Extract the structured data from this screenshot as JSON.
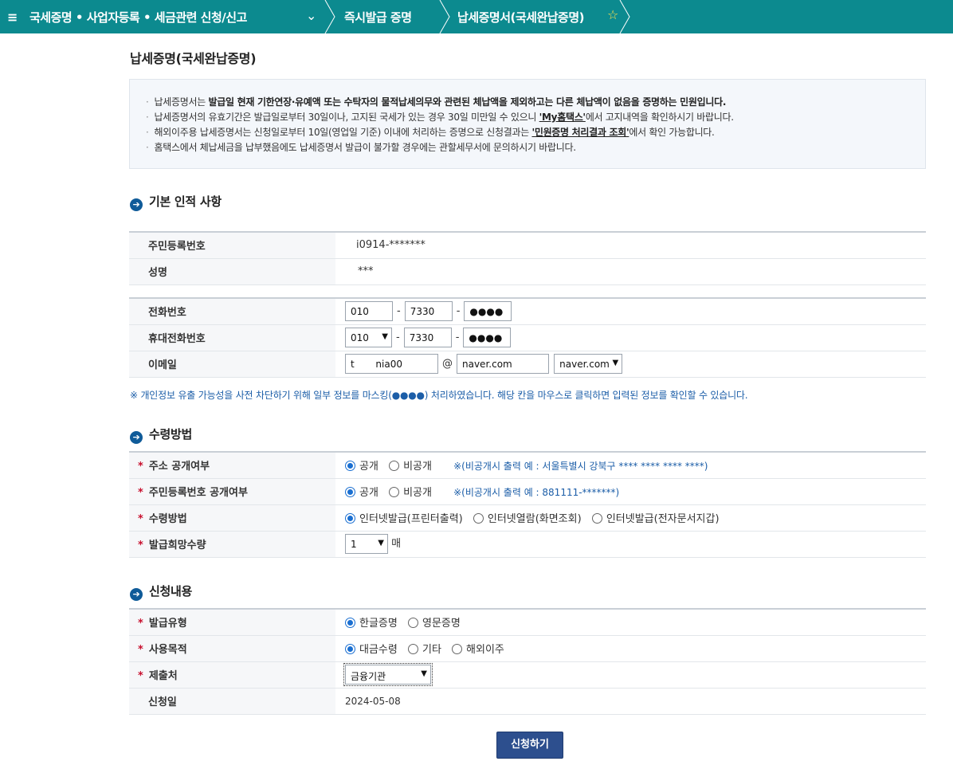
{
  "nav": {
    "menu_icon": "≡",
    "crumb1": "국세증명 • 사업자등록 • 세금관련 신청/신고",
    "chevron": "⌄",
    "crumb2": "즉시발급 증명",
    "crumb3": "납세증명서(국세완납증명)",
    "star": "☆"
  },
  "page_title": "납세증명(국세완납증명)",
  "notice": {
    "line1_a": "납세증명서는 ",
    "line1_b": "발급일 현재 기한연장·유예액 또는 수탁자의 물적납세의무와 관련된 체납액을 제외하고는 다른 체납액이 없음을 증명하는 민원입니다.",
    "line2_a": "납세증명서의 유효기간은 발급일로부터 30일이나, 고지된 국세가 있는 경우 30일 미만일 수 있으니 ",
    "line2_link": "'My홈택스'",
    "line2_b": "에서 고지내역을 확인하시기 바랍니다.",
    "line3_a": "해외이주용 납세증명서는 신청일로부터 10일(영업일 기준) 이내에 처리하는 증명으로 신청결과는 ",
    "line3_link": "'민원증명 처리결과 조회'",
    "line3_b": "에서 확인 가능합니다.",
    "line4": "홈택스에서 체납세금을 납부했음에도 납세증명서 발급이 불가할 경우에는 관할세무서에 문의하시기 바랍니다."
  },
  "section_basic": {
    "title": "기본 인적 사항",
    "rrn_label": "주민등록번호",
    "rrn_value": "i0914-*******",
    "name_label": "성명",
    "name_value": "***",
    "phone_label": "전화번호",
    "phone1": "010",
    "phone2": "7330",
    "phone3": "●●●●",
    "mobile_label": "휴대전화번호",
    "mobile1": "010",
    "mobile2": "7330",
    "mobile3": "●●●●",
    "email_label": "이메일",
    "email_id": "t       nia00",
    "email_at": "@",
    "email_domain": "naver.com",
    "email_domain_select": "naver.com",
    "dash": "-"
  },
  "mask_note": "※ 개인정보 유출 가능성을 사전 차단하기 위해 일부 정보를 마스킹(●●●●) 처리하였습니다. 해당 칸을 마우스로 클릭하면 입력된 정보를 확인할 수 있습니다.",
  "section_receive": {
    "title": "수령방법",
    "required_mark": "*",
    "addr_label": "주소 공개여부",
    "rrn_label": "주민등록번호 공개여부",
    "method_label": "수령방법",
    "qty_label": "발급희망수량",
    "public": "공개",
    "private": "비공개",
    "addr_hint": "※(비공개시 출력 예 : 서울특별시 강북구 **** **** **** ****)",
    "rrn_hint": "※(비공개시 출력 예 : 881111-*******)",
    "method_opt1": "인터넷발급(프린터출력)",
    "method_opt2": "인터넷열람(화면조회)",
    "method_opt3": "인터넷발급(전자문서지갑)",
    "qty_value": "1",
    "qty_unit": "매"
  },
  "section_apply": {
    "title": "신청내용",
    "required_mark": "*",
    "type_label": "발급유형",
    "type_opt1": "한글증명",
    "type_opt2": "영문증명",
    "purpose_label": "사용목적",
    "purpose_opt1": "대금수령",
    "purpose_opt2": "기타",
    "purpose_opt3": "해외이주",
    "submit_to_label": "제출처",
    "submit_to_value": "금융기관",
    "date_label": "신청일",
    "date_value": "2024-05-08"
  },
  "submit_button": "신청하기",
  "colors": {
    "nav_bg": "#0c8a8f",
    "accent": "#2d4f8e",
    "required": "#c8102e",
    "hint": "#1c5ea8"
  }
}
